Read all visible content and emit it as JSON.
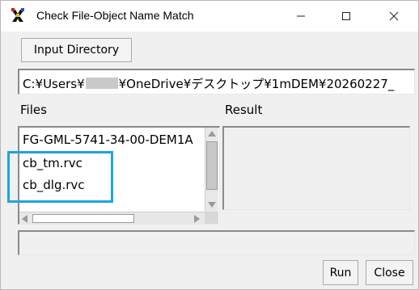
{
  "window": {
    "title": "Check File-Object Name Match"
  },
  "toolbar": {
    "input_directory_label": "Input Directory"
  },
  "path": {
    "prefix": "C:¥Users¥",
    "suffix": "¥OneDrive¥デスクトップ¥1mDEM¥20260227_"
  },
  "files": {
    "label": "Files",
    "items": [
      "FG-GML-5741-34-00-DEM1A",
      "cb_tm.rvc",
      "cb_dlg.rvc"
    ]
  },
  "result": {
    "label": "Result"
  },
  "buttons": {
    "run_label": "Run",
    "close_label": "Close"
  },
  "icons": {
    "app": "app-icon",
    "minimize": "minimize-icon",
    "maximize": "maximize-icon",
    "close": "close-icon"
  },
  "colors": {
    "highlight": "#1ea3e0"
  }
}
